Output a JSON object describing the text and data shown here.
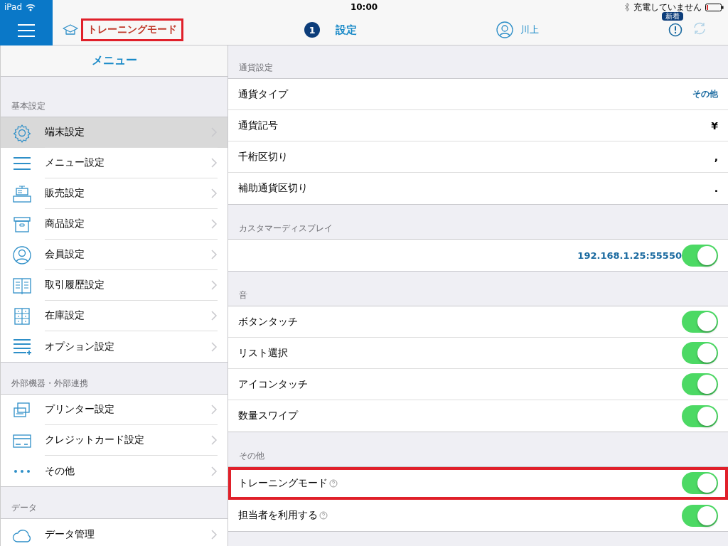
{
  "status_bar": {
    "device": "iPad",
    "time": "10:00",
    "charging": "充電していません"
  },
  "header": {
    "mode": {
      "label": "トレーニングモード",
      "highlighted": true
    },
    "step": "1",
    "title": "設定",
    "user": "川上",
    "badge": "新着",
    "refresh_disabled": true
  },
  "sidebar": {
    "title": "メニュー",
    "sections": [
      {
        "label": "基本設定",
        "items": [
          {
            "label": "端末設定",
            "selected": true
          },
          {
            "label": "メニュー設定",
            "selected": false
          },
          {
            "label": "販売設定",
            "selected": false
          },
          {
            "label": "商品設定",
            "selected": false
          },
          {
            "label": "会員設定",
            "selected": false
          },
          {
            "label": "取引履歴設定",
            "selected": false
          },
          {
            "label": "在庫設定",
            "selected": false
          },
          {
            "label": "オプション設定",
            "selected": false
          }
        ]
      },
      {
        "label": "外部機器・外部連携",
        "items": [
          {
            "label": "プリンター設定",
            "selected": false
          },
          {
            "label": "クレジットカード設定",
            "selected": false
          },
          {
            "label": "その他",
            "selected": false
          }
        ]
      },
      {
        "label": "データ",
        "items": [
          {
            "label": "データ管理",
            "selected": false
          }
        ]
      }
    ]
  },
  "settings": [
    {
      "label": "通貨設定",
      "rows": [
        {
          "kind": "link",
          "label": "通貨タイプ",
          "value": "その他"
        },
        {
          "kind": "value",
          "label": "通貨記号",
          "value": "¥"
        },
        {
          "kind": "value",
          "label": "千桁区切り",
          "value": ","
        },
        {
          "kind": "value",
          "label": "補助通貨区切り",
          "value": "."
        }
      ]
    },
    {
      "label": "カスタマーディスプレイ",
      "rows": [
        {
          "kind": "toggle",
          "value": "192.168.1.25:55550",
          "on": true
        }
      ]
    },
    {
      "label": "音",
      "rows": [
        {
          "kind": "toggle",
          "label": "ボタンタッチ",
          "on": true
        },
        {
          "kind": "toggle",
          "label": "リスト選択",
          "on": true
        },
        {
          "kind": "toggle",
          "label": "アイコンタッチ",
          "on": true
        },
        {
          "kind": "toggle",
          "label": "数量スワイプ",
          "on": true
        }
      ]
    },
    {
      "label": "その他",
      "rows": [
        {
          "kind": "toggle",
          "label": "トレーニングモード",
          "help": true,
          "on": true,
          "highlighted": true
        },
        {
          "kind": "toggle",
          "label": "担当者を利用する",
          "help": true,
          "on": true
        }
      ]
    }
  ]
}
